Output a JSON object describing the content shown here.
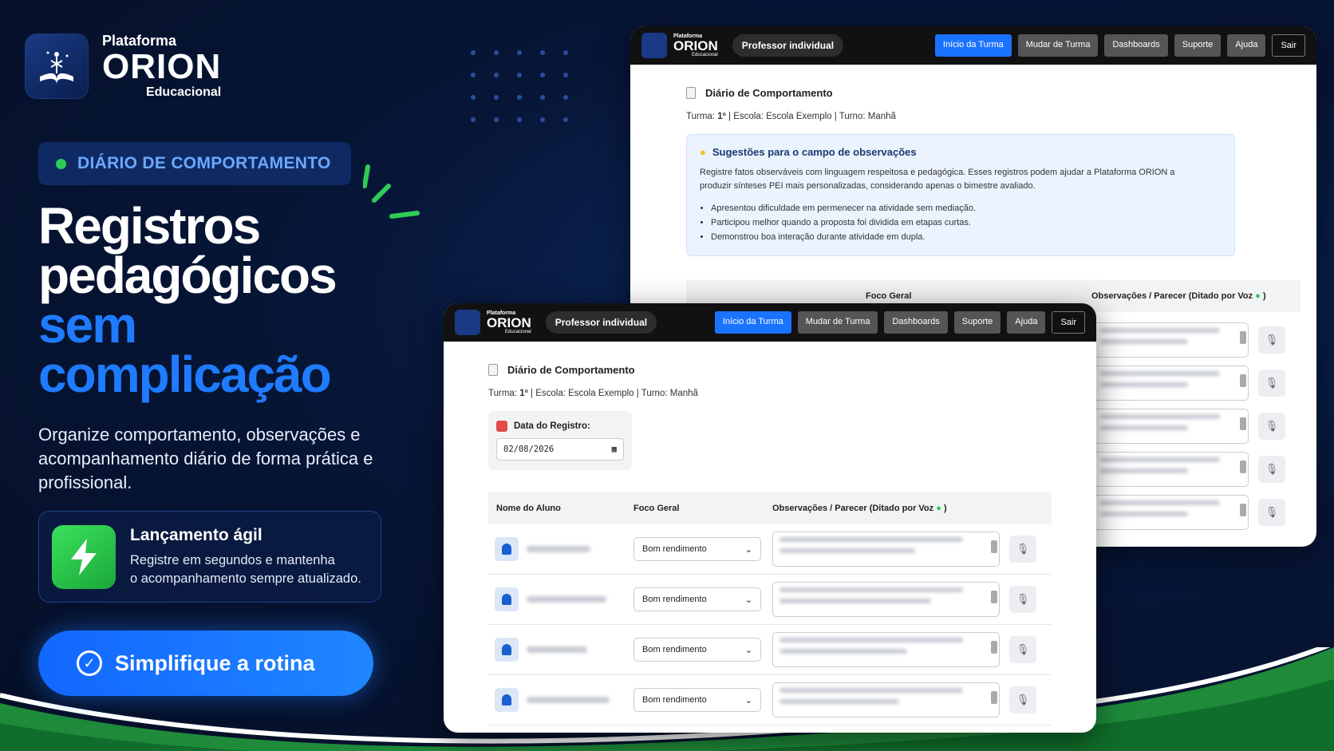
{
  "brand": {
    "line1": "Plataforma",
    "line2": "ORION",
    "line3": "Educacional"
  },
  "badge": "DIÁRIO DE COMPORTAMENTO",
  "headline": {
    "line1": "Registros",
    "line2": "pedagógicos",
    "line3": "sem",
    "line4": "complicação"
  },
  "description": "Organize comportamento, observações e acompanhamento diário de forma prática e profissional.",
  "feature": {
    "title": "Lançamento ágil",
    "line1": "Registre em segundos e mantenha",
    "line2": "o acompanhamento sempre atualizado."
  },
  "cta": "Simplifique a rotina",
  "colors": {
    "accent": "#1f7bff",
    "green": "#2ecc55",
    "bg": "#071637"
  },
  "app": {
    "logo": {
      "small": "Plataforma",
      "name": "ORION",
      "sub": "Educacional"
    },
    "profile": "Professor individual",
    "nav": [
      "Início da Turma",
      "Mudar de Turma",
      "Dashboards",
      "Suporte",
      "Ajuda",
      "Sair"
    ],
    "title": "Diário de Comportamento",
    "class_label": "Turma:",
    "class_value": "1º",
    "school_info": "| Escola: Escola Exemplo | Turno: Manhã",
    "suggestions": {
      "title": "Sugestões para o campo de observações",
      "text": "Registre fatos observáveis com linguagem respeitosa e pedagógica. Esses registros podem ajudar a Plataforma ORION a produzir sínteses PEI mais personalizadas, considerando apenas o bimestre avaliado.",
      "items": [
        "Apresentou dificuldade em permenecer na atividade sem mediação.",
        "Participou melhor quando a proposta foi dividida em etapas curtas.",
        "Demonstrou boa interação durante atividade em dupla."
      ]
    },
    "date_label": "Data do Registro:",
    "date_value": "02/08/2026",
    "columns": {
      "name": "Nome do Aluno",
      "focus": "Foco Geral",
      "obs": "Observações / Parecer (Ditado por Voz",
      "obs_end": ")"
    },
    "focus_value": "Bom rendimento"
  }
}
